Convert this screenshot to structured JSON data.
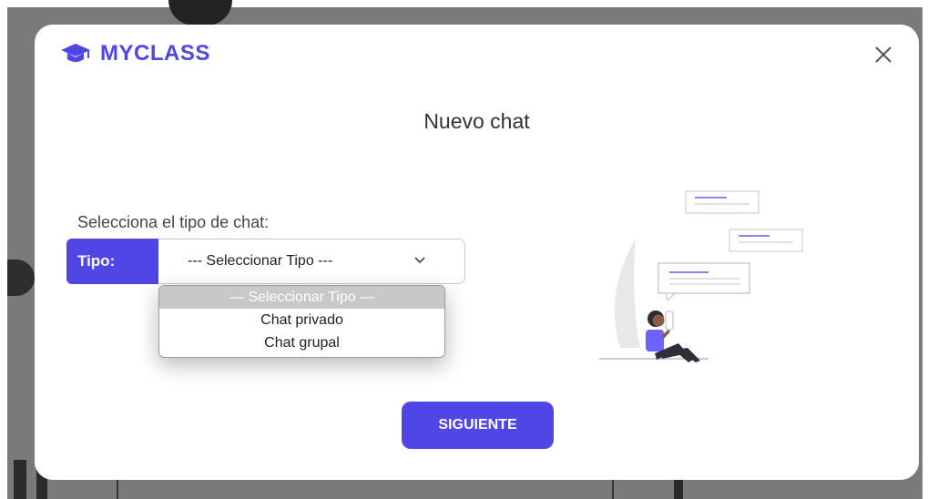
{
  "brand": {
    "name": "MYCLASS",
    "icon": "graduation-cap-icon",
    "color": "#4f46e5"
  },
  "modal": {
    "title": "Nuevo chat",
    "close_icon": "close-icon"
  },
  "form": {
    "prompt": "Selecciona el tipo de chat:",
    "type_label": "Tipo:",
    "selected_value": "--- Seleccionar Tipo ---",
    "options": [
      {
        "label": "— Seleccionar Tipo —",
        "disabled": true
      },
      {
        "label": "Chat privado"
      },
      {
        "label": "Chat grupal"
      }
    ]
  },
  "actions": {
    "next_label": "SIGUIENTE"
  },
  "colors": {
    "accent": "#4f46e5",
    "text": "#333333"
  }
}
